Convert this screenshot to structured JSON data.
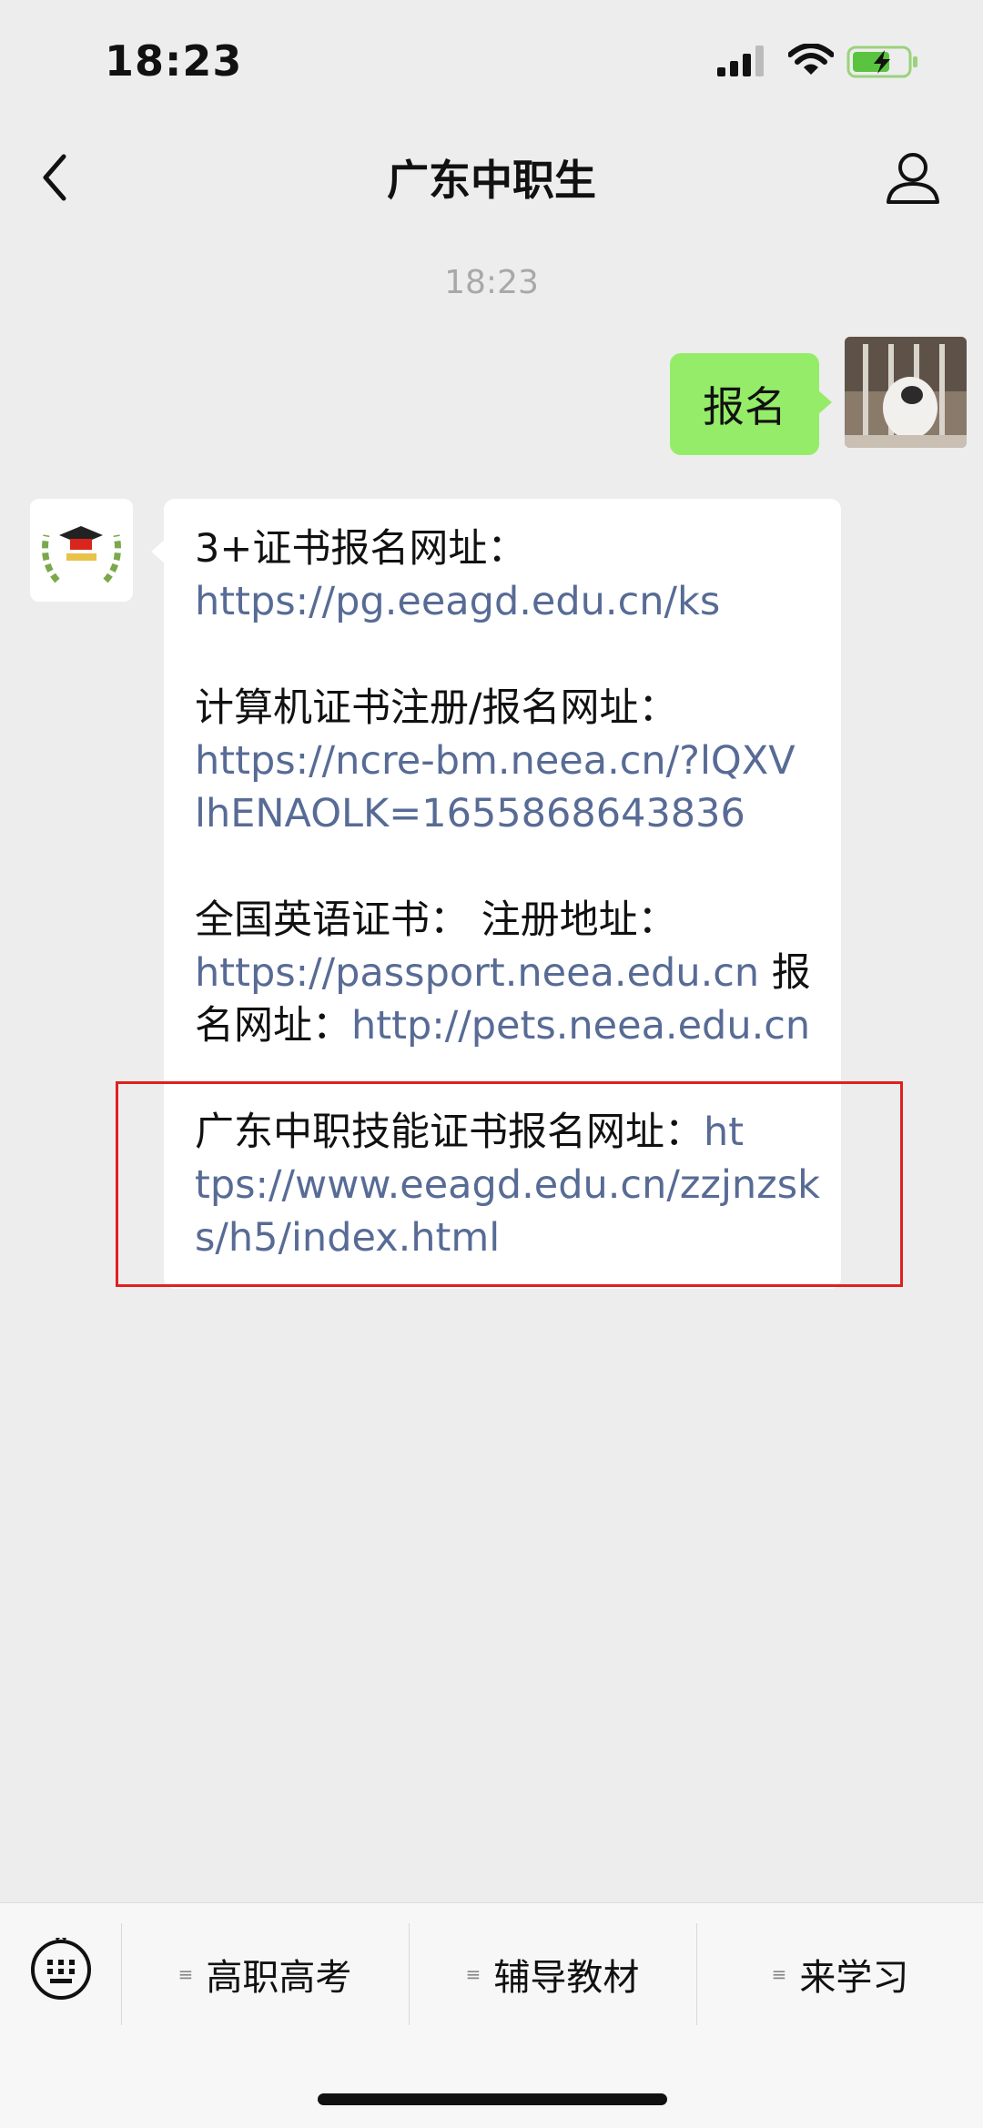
{
  "status_bar": {
    "time": "18:23"
  },
  "nav": {
    "title": "广东中职生"
  },
  "chat": {
    "timestamp": "18:23",
    "sent_message": "报名",
    "received": {
      "l1": "3+证书报名网址：",
      "l2": "https://pg.eeagd.edu.cn/ks",
      "l3": "计算机证书注册/报名网址：",
      "l4": "https://ncre-bm.neea.cn/?lQXV",
      "l5": "lhENAOLK=1655868643836",
      "l6": "全国英语证书： 注册地址：",
      "l7_link": "https://passport.neea.edu.cn",
      "l7_text": " 报",
      "l8_text": "名网址：",
      "l8_link": "http://pets.neea.edu.cn",
      "l9_text": "广东中职技能证书报名网址：",
      "l9_link": "ht",
      "l10": "tps://www.eeagd.edu.cn/zzjnzsk",
      "l11": "s/h5/index.html"
    }
  },
  "menu": {
    "items": [
      {
        "label": "高职高考"
      },
      {
        "label": "辅导教材"
      },
      {
        "label": "来学习"
      }
    ]
  },
  "colors": {
    "sent_bubble": "#95ec69",
    "link": "#576b95",
    "highlight_border": "#e02020",
    "background": "#ededed"
  }
}
